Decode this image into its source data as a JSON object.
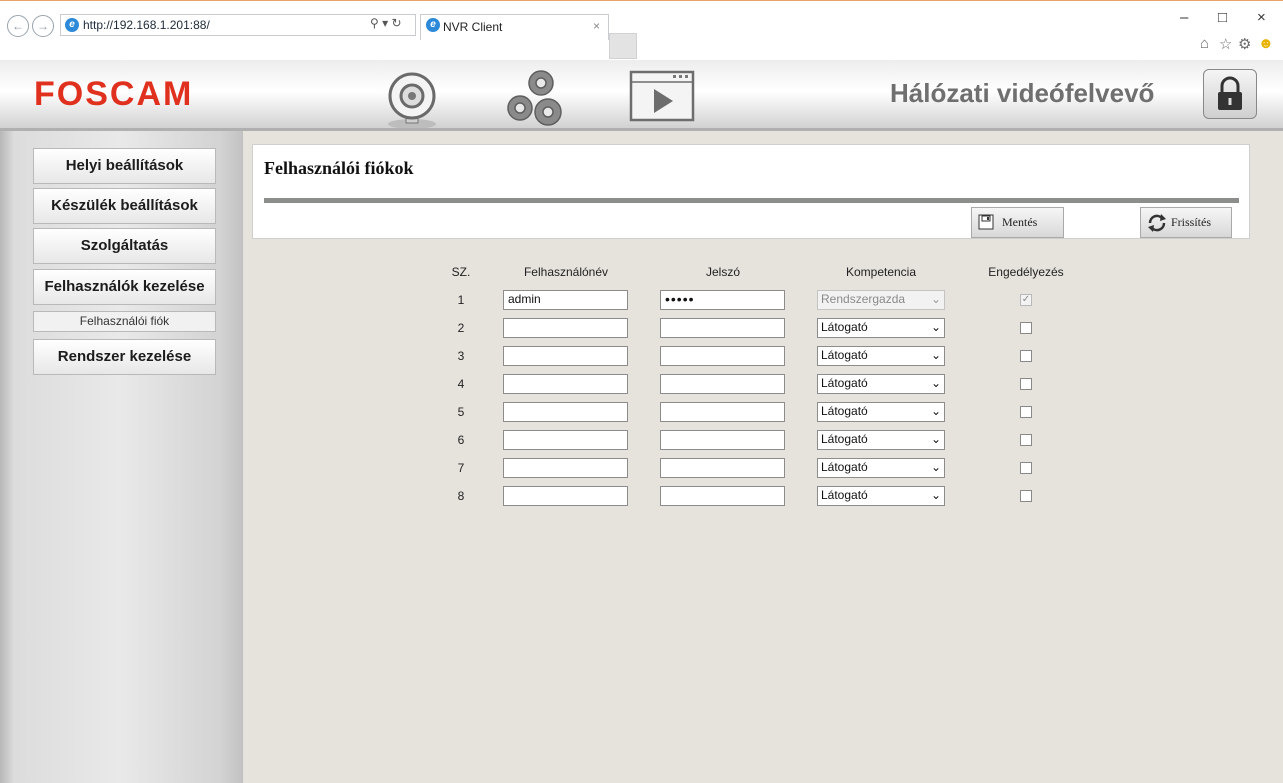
{
  "browser": {
    "url": "http://192.168.1.201:88/",
    "tab_title": "NVR Client",
    "back_icon": "back-arrow-icon",
    "forward_icon": "forward-arrow-icon"
  },
  "header": {
    "logo": "FOSCAM",
    "device_title": "Hálózati videófelvevő",
    "nav_icons": [
      "camera-icon",
      "settings-gears-icon",
      "playback-icon"
    ],
    "lock_icon": "lock-icon"
  },
  "sidebar": {
    "items": [
      {
        "label": "Helyi beállítások"
      },
      {
        "label": "Készülék beállítások"
      },
      {
        "label": "Szolgáltatás"
      },
      {
        "label": "Felhasználók kezelése"
      },
      {
        "label": "Felhasználói fiók"
      },
      {
        "label": "Rendszer kezelése"
      }
    ]
  },
  "panel": {
    "title": "Felhasználói fiókok",
    "save_label": "Mentés",
    "refresh_label": "Frissítés"
  },
  "table": {
    "headers": {
      "no": "SZ.",
      "username": "Felhasználónév",
      "password": "Jelszó",
      "role": "Kompetencia",
      "enabled": "Engedélyezés"
    },
    "rows": [
      {
        "no": "1",
        "username": "admin",
        "password": "•••••",
        "role": "Rendszergazda",
        "enabled": true,
        "locked": true
      },
      {
        "no": "2",
        "username": "",
        "password": "",
        "role": "Látogató",
        "enabled": false,
        "locked": false
      },
      {
        "no": "3",
        "username": "",
        "password": "",
        "role": "Látogató",
        "enabled": false,
        "locked": false
      },
      {
        "no": "4",
        "username": "",
        "password": "",
        "role": "Látogató",
        "enabled": false,
        "locked": false
      },
      {
        "no": "5",
        "username": "",
        "password": "",
        "role": "Látogató",
        "enabled": false,
        "locked": false
      },
      {
        "no": "6",
        "username": "",
        "password": "",
        "role": "Látogató",
        "enabled": false,
        "locked": false
      },
      {
        "no": "7",
        "username": "",
        "password": "",
        "role": "Látogató",
        "enabled": false,
        "locked": false
      },
      {
        "no": "8",
        "username": "",
        "password": "",
        "role": "Látogató",
        "enabled": false,
        "locked": false
      }
    ]
  },
  "colors": {
    "logo_red": "#e0301e",
    "content_bg": "#e6e3dd",
    "panel_rule": "#8b8e8b"
  }
}
